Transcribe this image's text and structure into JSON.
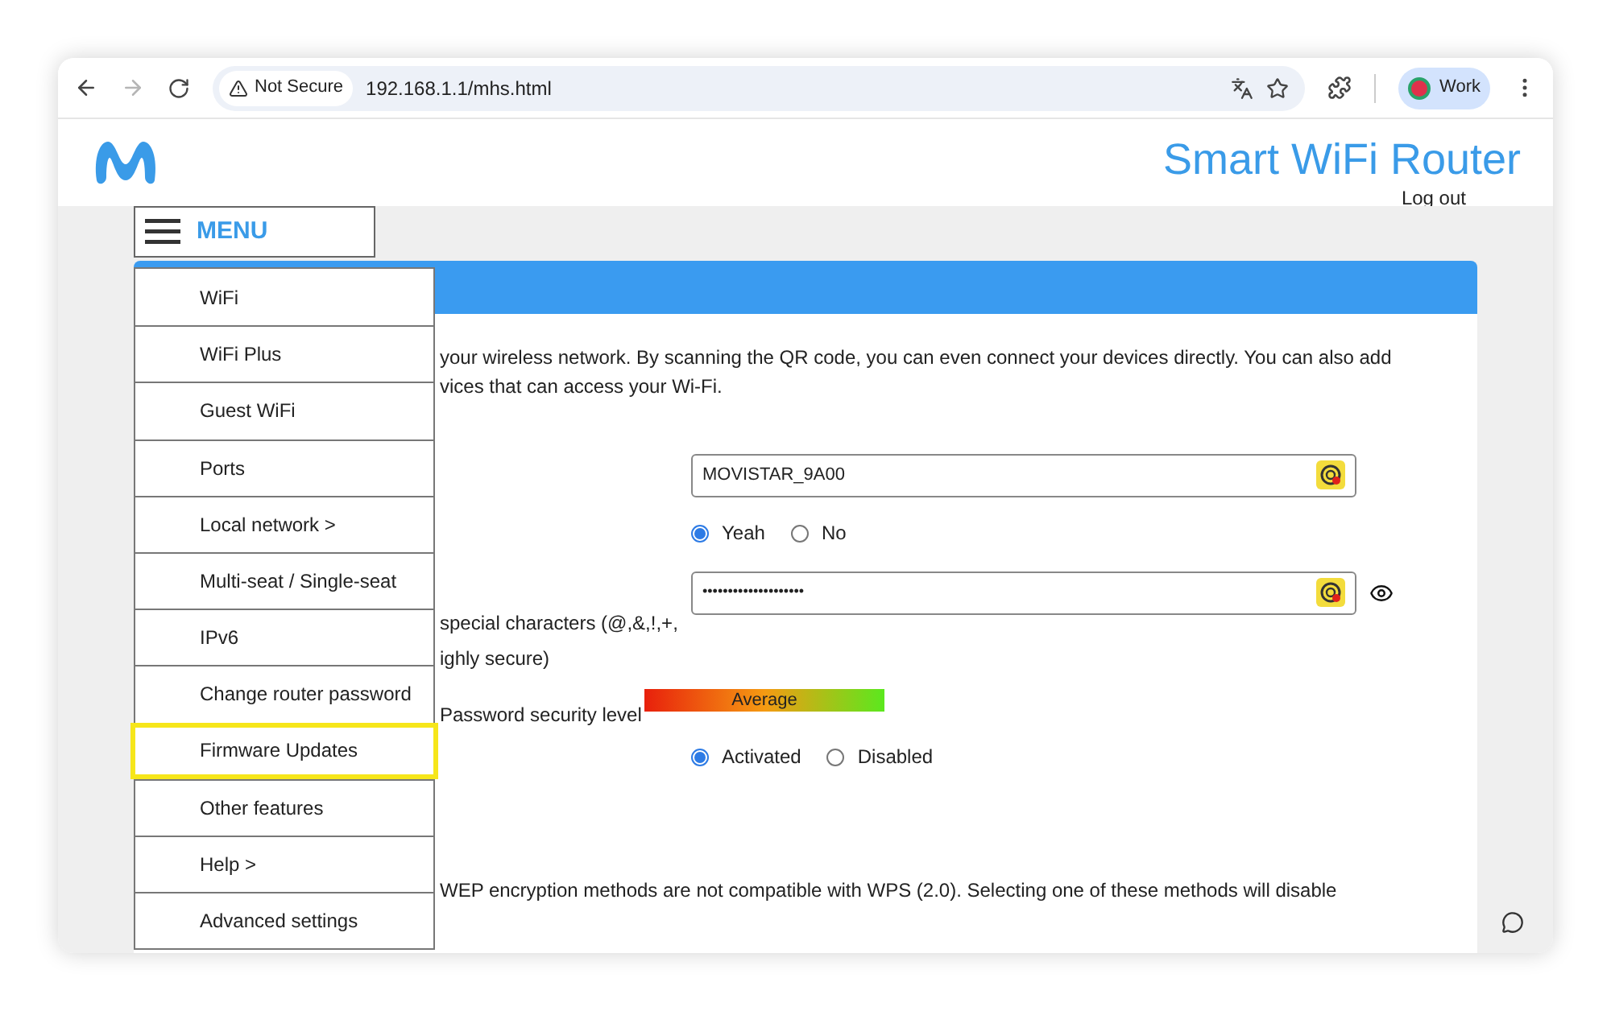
{
  "browser": {
    "forward_enabled": false,
    "security_label": "Not Secure",
    "url": "192.168.1.1/mhs.html",
    "profile": "Work"
  },
  "header": {
    "title": "Smart WiFi Router",
    "logout": "Log out"
  },
  "menu": {
    "label": "MENU",
    "items": [
      {
        "label": "WiFi",
        "highlighted": false
      },
      {
        "label": "WiFi Plus",
        "highlighted": false
      },
      {
        "label": "Guest WiFi",
        "highlighted": false
      },
      {
        "label": "Ports",
        "highlighted": false
      },
      {
        "label": "Local network >",
        "highlighted": false
      },
      {
        "label": "Multi-seat / Single-seat",
        "highlighted": false
      },
      {
        "label": "IPv6",
        "highlighted": false
      },
      {
        "label": "Change router password",
        "highlighted": false
      },
      {
        "label": "Firmware Updates",
        "highlighted": true
      },
      {
        "label": "Other features",
        "highlighted": false
      },
      {
        "label": "Help >",
        "highlighted": false
      },
      {
        "label": "Advanced settings",
        "highlighted": false
      }
    ]
  },
  "intro": [
    "your wireless network. By scanning the QR code, you can even connect your devices directly. You can also add",
    "vices that can access your Wi-Fi."
  ],
  "ssid": {
    "value": "MOVISTAR_9A00"
  },
  "broadcast": [
    {
      "label": "Yeah",
      "selected": true
    },
    {
      "label": "No",
      "selected": false
    }
  ],
  "password": {
    "value": "••••••••••••••••••••",
    "hint": [
      "special characters (@,&,!,+,",
      "ighly secure)"
    ]
  },
  "strength": {
    "label": "Password security level",
    "rating": "Average"
  },
  "wps": [
    {
      "label": "Activated",
      "selected": true
    },
    {
      "label": "Disabled",
      "selected": false
    }
  ],
  "note": "WEP encryption methods are not compatible with WPS (2.0). Selecting one of these methods will disable"
}
